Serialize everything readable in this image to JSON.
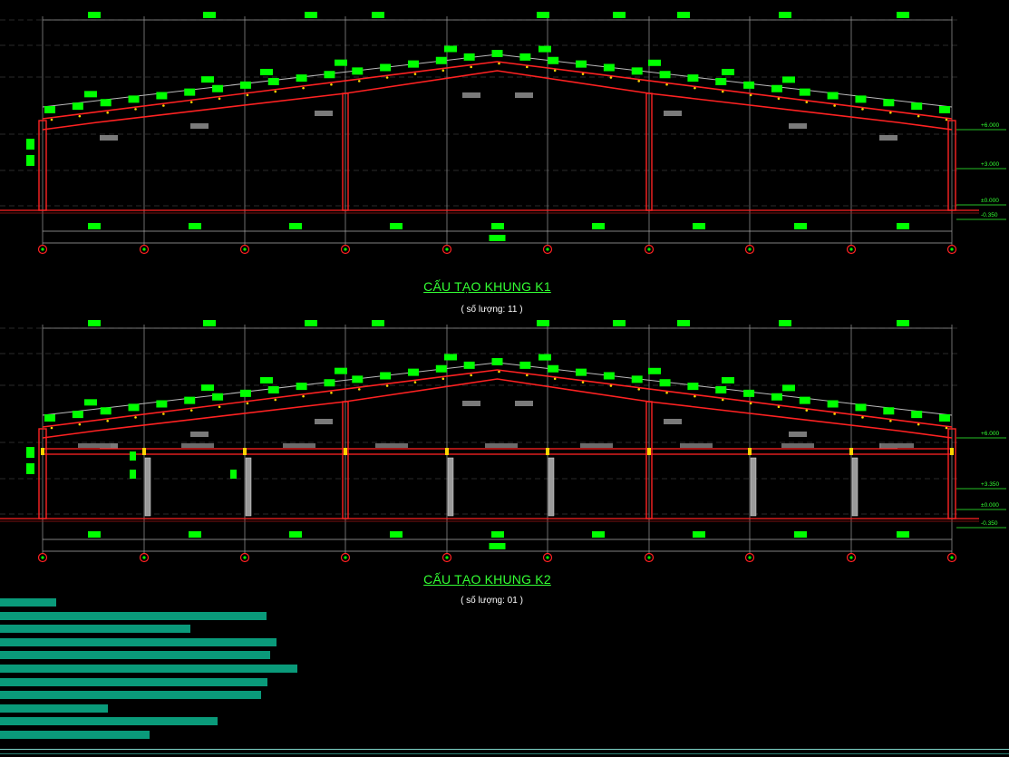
{
  "frames": [
    {
      "id": "k1",
      "title": "CẤU TẠO KHUNG K1",
      "subtitle": "( số lượng: 11 )",
      "levels": [
        "+6.000",
        "+3.000",
        "±0.000",
        "-0.350"
      ],
      "has_mezzanine": false
    },
    {
      "id": "k2",
      "title": "CẤU TẠO KHUNG K2",
      "subtitle": "( số lượng: 01 )",
      "levels": [
        "+6.000",
        "+3.350",
        "±0.000",
        "-0.350"
      ],
      "has_mezzanine": true
    }
  ],
  "grid_axis_count": 10,
  "colors": {
    "background": "#000000",
    "frame": "#ff2222",
    "purlin": "#00ff00",
    "dimension": "#ffffff",
    "level": "#33ff33",
    "teal_bar": "#0a9a7a"
  },
  "teal_bars": [
    {
      "name": "bar-1",
      "length": 0.056
    },
    {
      "name": "bar-2",
      "length": 0.264
    },
    {
      "name": "bar-3",
      "length": 0.189
    },
    {
      "name": "bar-4",
      "length": 0.274
    },
    {
      "name": "bar-5",
      "length": 0.268
    },
    {
      "name": "bar-6",
      "length": 0.295
    },
    {
      "name": "bar-7",
      "length": 0.265
    },
    {
      "name": "bar-8",
      "length": 0.259
    },
    {
      "name": "bar-9",
      "length": 0.107
    },
    {
      "name": "bar-10",
      "length": 0.216
    },
    {
      "name": "bar-11",
      "length": 0.148
    }
  ]
}
